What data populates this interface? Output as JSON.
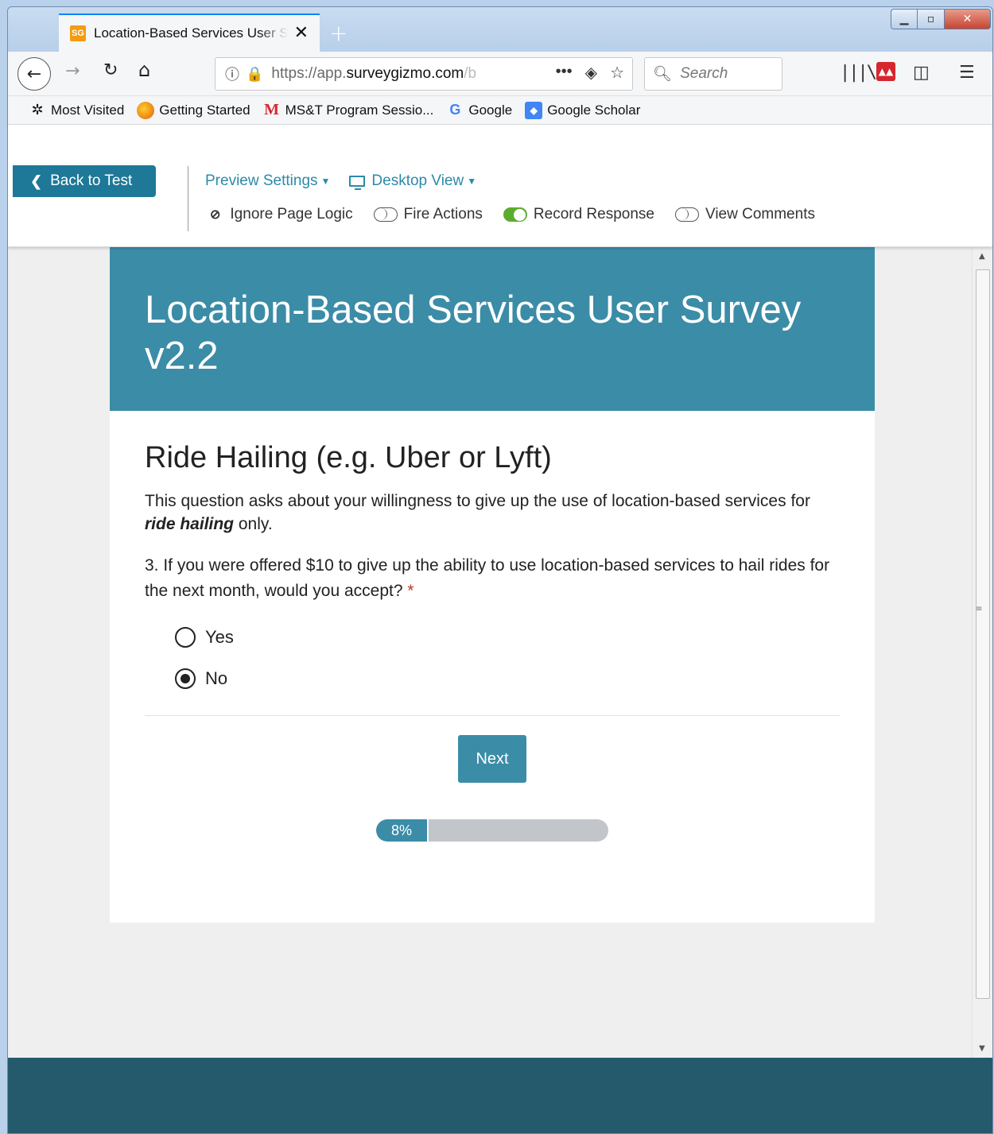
{
  "browser": {
    "tab_title": "Location-Based Services User Survey",
    "favicon_text": "SG",
    "url_prefix": "https://app.",
    "url_domain": "surveygizmo.com",
    "url_suffix": "/b",
    "search_placeholder": "Search",
    "bookmarks": [
      {
        "label": "Most Visited",
        "icon": "gear-icon"
      },
      {
        "label": "Getting Started",
        "icon": "firefox-icon"
      },
      {
        "label": "MS&T Program Sessio...",
        "icon": "m-logo-icon"
      },
      {
        "label": "Google",
        "icon": "google-icon"
      },
      {
        "label": "Google Scholar",
        "icon": "google-scholar-icon"
      }
    ]
  },
  "preview": {
    "back_label": "Back to Test",
    "settings_label": "Preview Settings",
    "view_label": "Desktop View",
    "ignore_logic_label": "Ignore Page Logic",
    "fire_actions_label": "Fire Actions",
    "record_response_label": "Record Response",
    "view_comments_label": "View Comments",
    "fire_actions_on": false,
    "record_response_on": true,
    "view_comments_on": false
  },
  "survey": {
    "title": "Location-Based Services User Survey v2.2",
    "section_title": "Ride Hailing (e.g. Uber or Lyft)",
    "intro_before": "This question asks about your willingness to give up the use of location-based services for ",
    "intro_emph": "ride hailing",
    "intro_after": " only.",
    "question": "3. If you were offered $10 to give up the ability to use location-based services to hail rides for the next month, would you accept?",
    "required_mark": "*",
    "options": [
      {
        "label": "Yes",
        "selected": false
      },
      {
        "label": "No",
        "selected": true
      }
    ],
    "next_label": "Next",
    "progress_label": "8%",
    "progress_value": 0.08
  },
  "colors": {
    "brand": "#3b8ca7",
    "footer": "#245a6b",
    "link": "#2b8aa8",
    "toggle_on": "#5dac2e"
  }
}
